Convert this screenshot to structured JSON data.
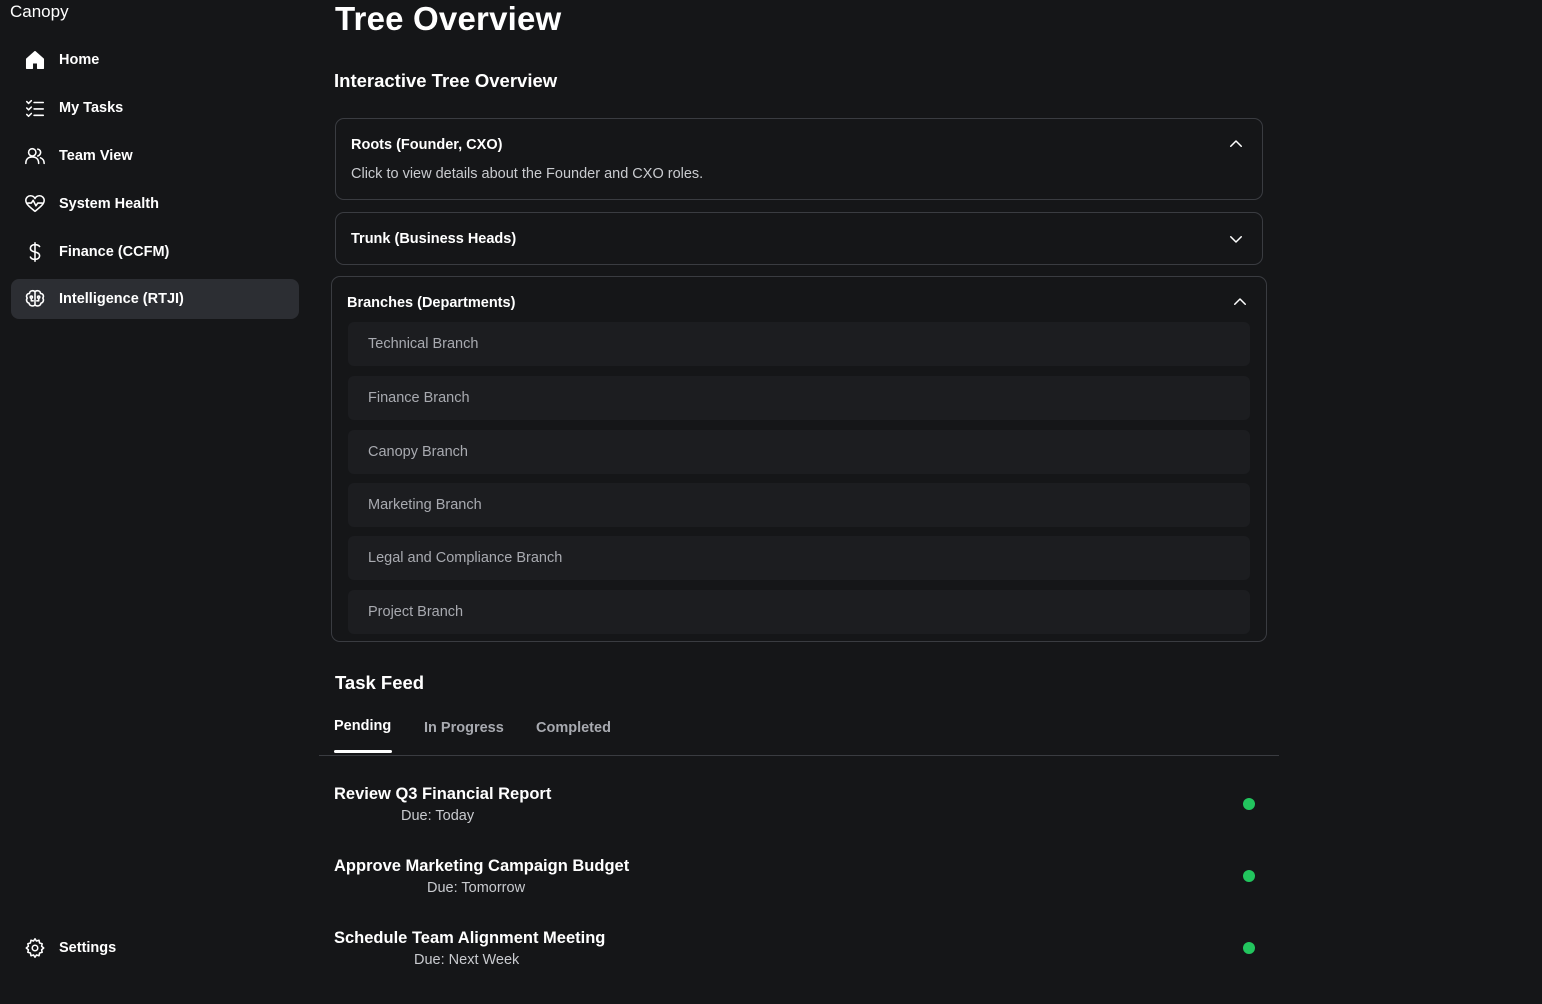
{
  "app": {
    "name": "Canopy"
  },
  "sidebar": {
    "items": [
      {
        "label": "Home",
        "icon": "home-icon"
      },
      {
        "label": "My Tasks",
        "icon": "task-list-icon"
      },
      {
        "label": "Team View",
        "icon": "users-icon"
      },
      {
        "label": "System Health",
        "icon": "heart-pulse-icon"
      },
      {
        "label": "Finance (CCFM)",
        "icon": "dollar-icon"
      },
      {
        "label": "Intelligence (RTJI)",
        "icon": "brain-icon",
        "active": true
      }
    ],
    "settings": {
      "label": "Settings",
      "icon": "gear-icon"
    }
  },
  "page": {
    "title": "Tree Overview",
    "section_title": "Interactive Tree Overview"
  },
  "tree": {
    "roots": {
      "title": "Roots (Founder, CXO)",
      "description": "Click to view details about the Founder and CXO roles.",
      "expanded": true
    },
    "trunk": {
      "title": "Trunk (Business Heads)",
      "expanded": false
    },
    "branches": {
      "title": "Branches (Departments)",
      "expanded": true,
      "items": [
        "Technical Branch",
        "Finance Branch",
        "Canopy Branch",
        "Marketing Branch",
        "Legal and Compliance Branch",
        "Project Branch"
      ]
    }
  },
  "task_feed": {
    "title": "Task Feed",
    "tabs": [
      {
        "label": "Pending",
        "active": true
      },
      {
        "label": "In Progress",
        "active": false
      },
      {
        "label": "Completed",
        "active": false
      }
    ],
    "tasks": [
      {
        "title": "Review Q3 Financial Report",
        "due": "Due: Today",
        "status_color": "#22c55e"
      },
      {
        "title": "Approve Marketing Campaign Budget",
        "due": "Due: Tomorrow",
        "status_color": "#22c55e"
      },
      {
        "title": "Schedule Team Alignment Meeting",
        "due": "Due: Next Week",
        "status_color": "#22c55e"
      }
    ]
  },
  "colors": {
    "background": "#151618",
    "active_nav": "#2c2e33",
    "card_border": "#3a3c41",
    "branch_item_bg": "#1c1d20",
    "status_green": "#22c55e"
  }
}
